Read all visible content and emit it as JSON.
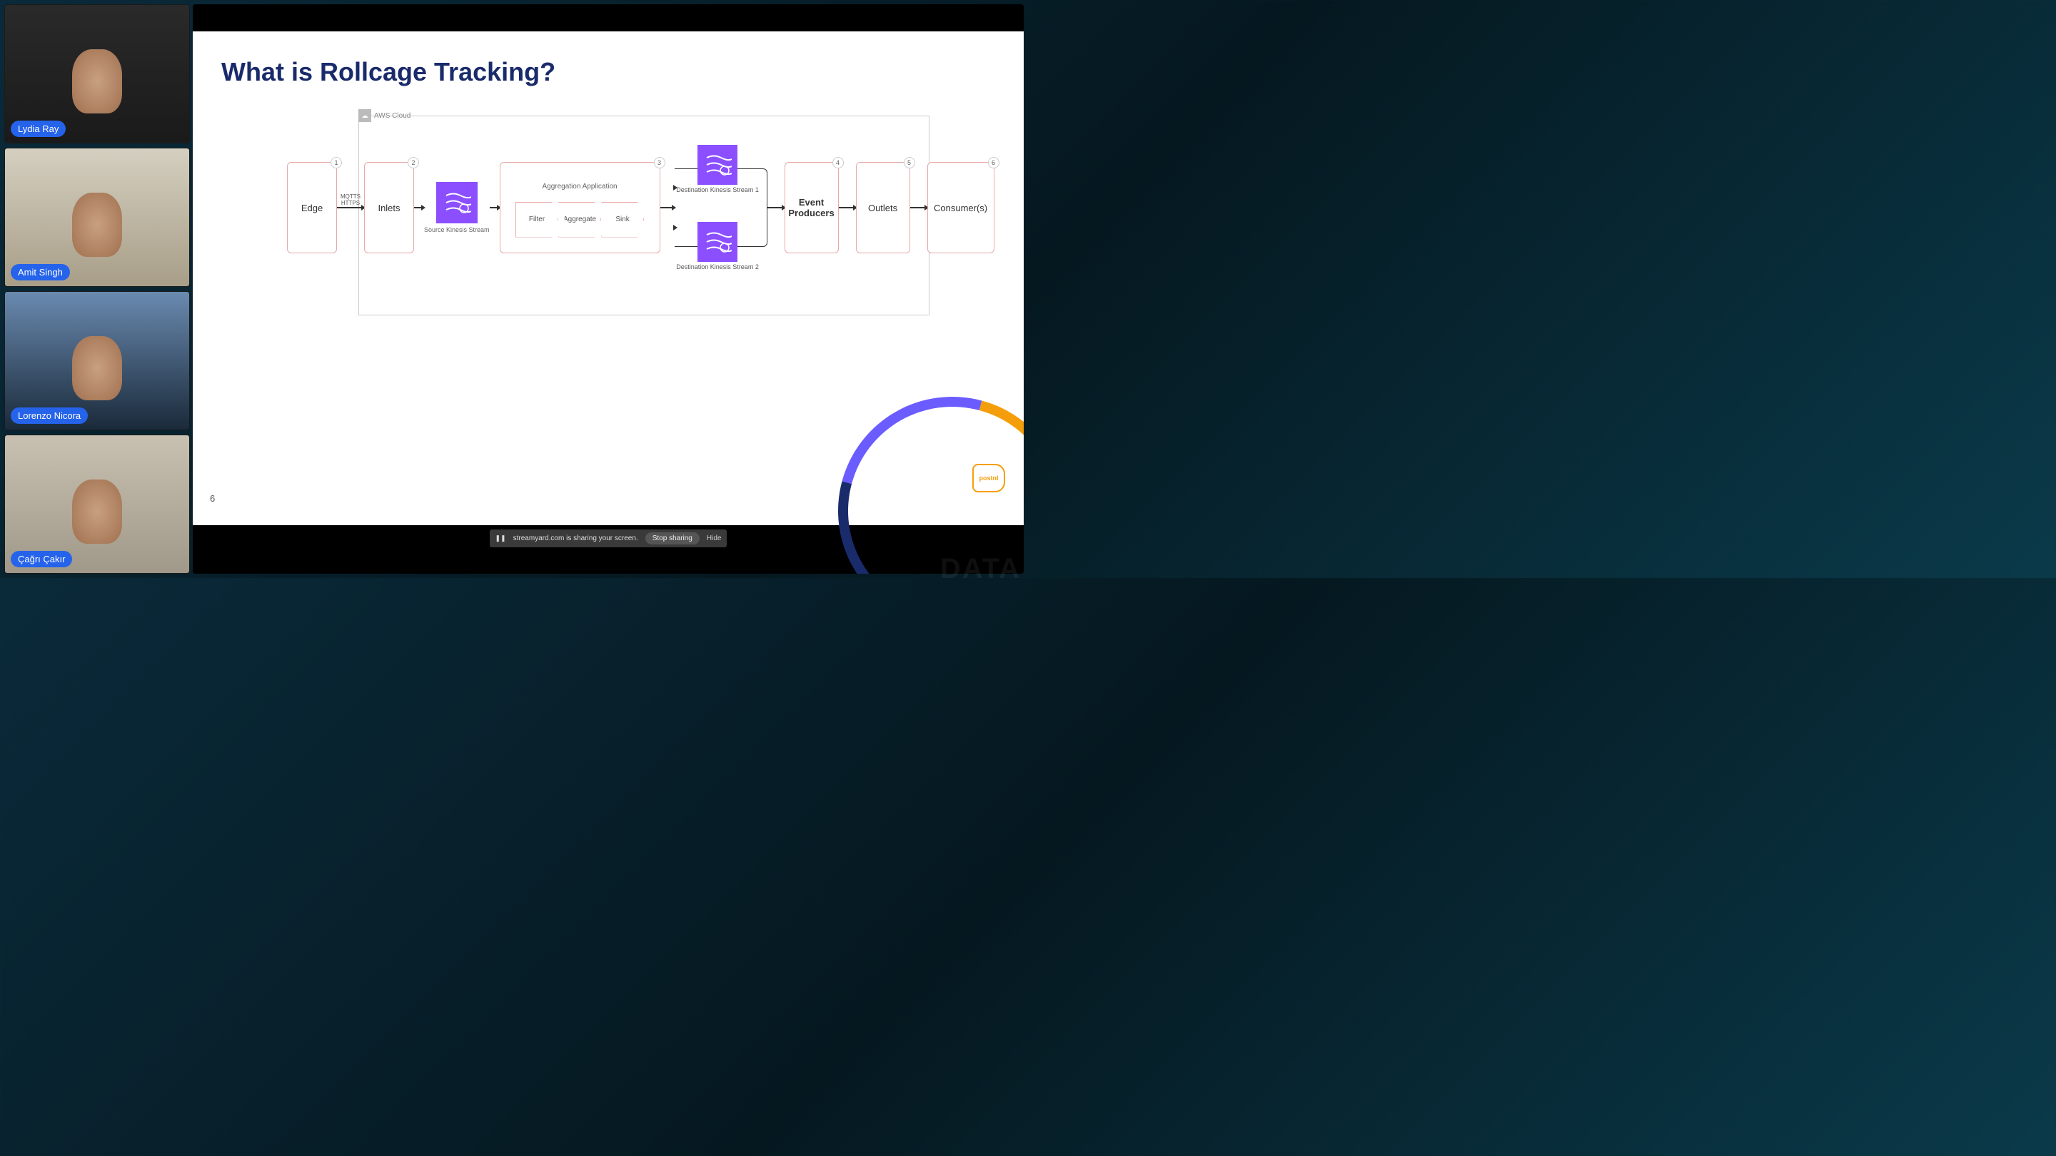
{
  "participants": [
    {
      "name": "Lydia Ray"
    },
    {
      "name": "Amit Singh"
    },
    {
      "name": "Lorenzo Nicora"
    },
    {
      "name": "Çağrı Çakır"
    }
  ],
  "slide": {
    "title": "What is Rollcage Tracking?",
    "page_number": "6",
    "aws_label": "AWS Cloud",
    "aggregation_title": "Aggregation Application",
    "protocol_label": "MQTTS\nHTTPS",
    "source_kinesis_label": "Source Kinesis Stream",
    "dest_kinesis_1_label": "Destination Kinesis Stream 1",
    "dest_kinesis_2_label": "Destination Kinesis Stream 2",
    "stages": {
      "filter": "Filter",
      "aggregate": "Aggregate",
      "sink": "Sink"
    },
    "boxes": {
      "edge": {
        "label": "Edge",
        "num": "1"
      },
      "inlets": {
        "label": "Inlets",
        "num": "2"
      },
      "aggregation": {
        "num": "3"
      },
      "event_producers": {
        "label": "Event\nProducers",
        "num": "4"
      },
      "outlets": {
        "label": "Outlets",
        "num": "5"
      },
      "consumers": {
        "label": "Consumer(s)",
        "num": "6"
      }
    },
    "logo_text": "postnl"
  },
  "share_bar": {
    "message": "streamyard.com is sharing your screen.",
    "stop_label": "Stop sharing",
    "hide_label": "Hide"
  }
}
